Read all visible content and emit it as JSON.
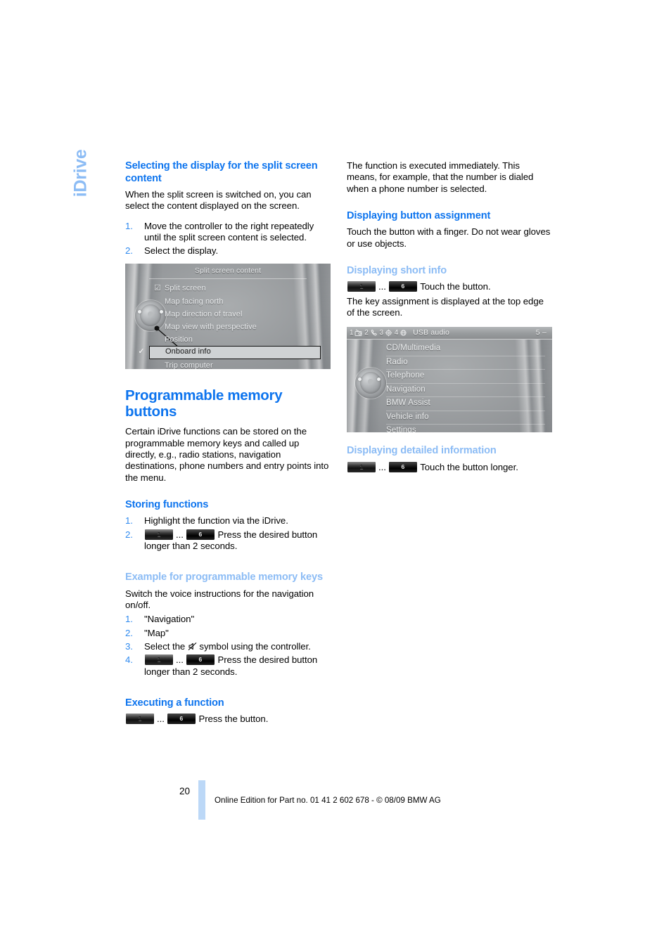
{
  "chapter": {
    "tab_label": "iDrive"
  },
  "footer": {
    "page_number": "20",
    "credit": "Online Edition for Part no. 01 41 2 602 678 - © 08/09 BMW AG"
  },
  "left_column": {
    "section_split": {
      "heading": "Selecting the display for the split screen content",
      "intro": "When the split screen is switched on, you can select the content displayed on the screen.",
      "steps": [
        {
          "num": "1.",
          "text": "Move the controller to the right repeatedly until the split screen content is selected."
        },
        {
          "num": "2.",
          "text": "Select the display."
        }
      ]
    },
    "split_screenshot": {
      "title": "Split screen content",
      "rows": [
        {
          "tick": "☑",
          "label": "Split screen",
          "selected": false
        },
        {
          "tick": "",
          "label": "Map facing north",
          "selected": false
        },
        {
          "tick": "",
          "label": "Map direction of travel",
          "selected": false
        },
        {
          "tick": "",
          "label": "Map view with perspective",
          "selected": false
        },
        {
          "tick": "",
          "label": "Position",
          "selected": false
        },
        {
          "tick": "✓",
          "label": "Onboard info",
          "selected": true
        },
        {
          "tick": "",
          "label": "Trip computer",
          "selected": false
        }
      ]
    },
    "section_memory": {
      "heading": "Programmable memory buttons",
      "intro": "Certain iDrive functions can be stored on the programmable memory keys and called up directly, e.g., radio stations, navigation destinations, phone numbers and entry points into the menu."
    },
    "section_storing": {
      "heading": "Storing functions",
      "step1_num": "1.",
      "step1_text": "Highlight the function via the iDrive.",
      "step2_num": "2.",
      "step2_btn_from": "1",
      "step2_ellipsis": "...",
      "step2_btn_to": "6",
      "step2_text": "Press the desired button longer than 2 seconds."
    },
    "section_example": {
      "heading": "Example for programmable memory keys",
      "intro": "Switch the voice instructions for the navigation on/off.",
      "step1_num": "1.",
      "step1_text": "\"Navigation\"",
      "step2_num": "2.",
      "step2_text": "\"Map\"",
      "step3_num": "3.",
      "step3_text_before": "Select the",
      "step3_icon": "voice-instructions-off-icon",
      "step3_text_after": "symbol using the controller.",
      "step4_num": "4.",
      "step4_btn_from": "1",
      "step4_ellipsis": "...",
      "step4_btn_to": "6",
      "step4_text": "Press the desired button longer than 2 seconds."
    },
    "section_executing": {
      "heading": "Executing a function",
      "btn_from": "1",
      "ellipsis": "...",
      "btn_to": "6",
      "text": "Press the button."
    }
  },
  "right_column": {
    "intro": "The function is executed immediately. This means, for example, that the number is dialed when a phone number is selected.",
    "section_assignment": {
      "heading": "Displaying button assignment",
      "text": "Touch the button with a finger. Do not wear gloves or use objects."
    },
    "section_shortinfo": {
      "heading": "Displaying short info",
      "btn_from": "1",
      "ellipsis": "...",
      "btn_to": "6",
      "text": "Touch the button.",
      "note": "The key assignment is displayed at the top edge of the screen."
    },
    "menu_screenshot": {
      "statusbar": {
        "slots": [
          {
            "num": "1",
            "icon": "radio-icon"
          },
          {
            "num": "2",
            "icon": "phone-icon"
          },
          {
            "num": "3",
            "icon": "gear-icon"
          },
          {
            "num": "4",
            "icon": "globe-icon"
          }
        ],
        "source": "USB audio",
        "right": "5 –"
      },
      "items": [
        "CD/Multimedia",
        "Radio",
        "Telephone",
        "Navigation",
        "BMW Assist",
        "Vehicle info",
        "Settings"
      ]
    },
    "section_detailed": {
      "heading": "Displaying detailed information",
      "btn_from": "1",
      "ellipsis": "...",
      "btn_to": "6",
      "text": "Touch the button longer."
    }
  },
  "colors": {
    "heading_blue": "#0d74ee",
    "heading_light_blue": "#8cbcf5",
    "list_number_blue": "#2f8aef",
    "footer_bar": "#bcd8f7"
  }
}
